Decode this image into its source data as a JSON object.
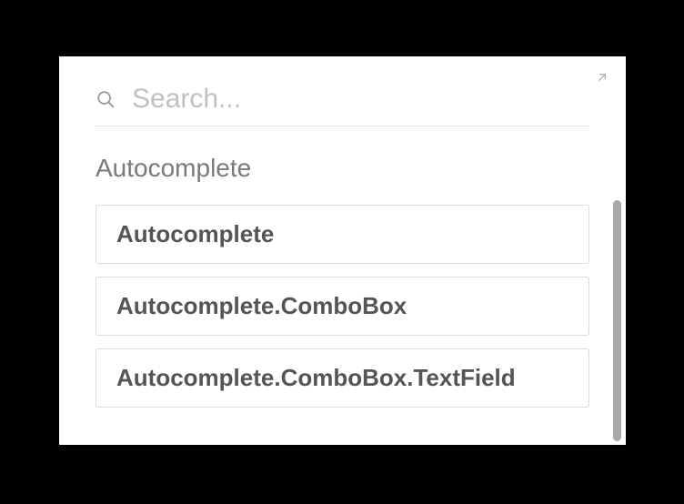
{
  "search": {
    "placeholder": "Search..."
  },
  "section": {
    "label": "Autocomplete"
  },
  "results": [
    {
      "title": "Autocomplete"
    },
    {
      "title": "Autocomplete.ComboBox"
    },
    {
      "title": "Autocomplete.ComboBox.TextField"
    }
  ]
}
